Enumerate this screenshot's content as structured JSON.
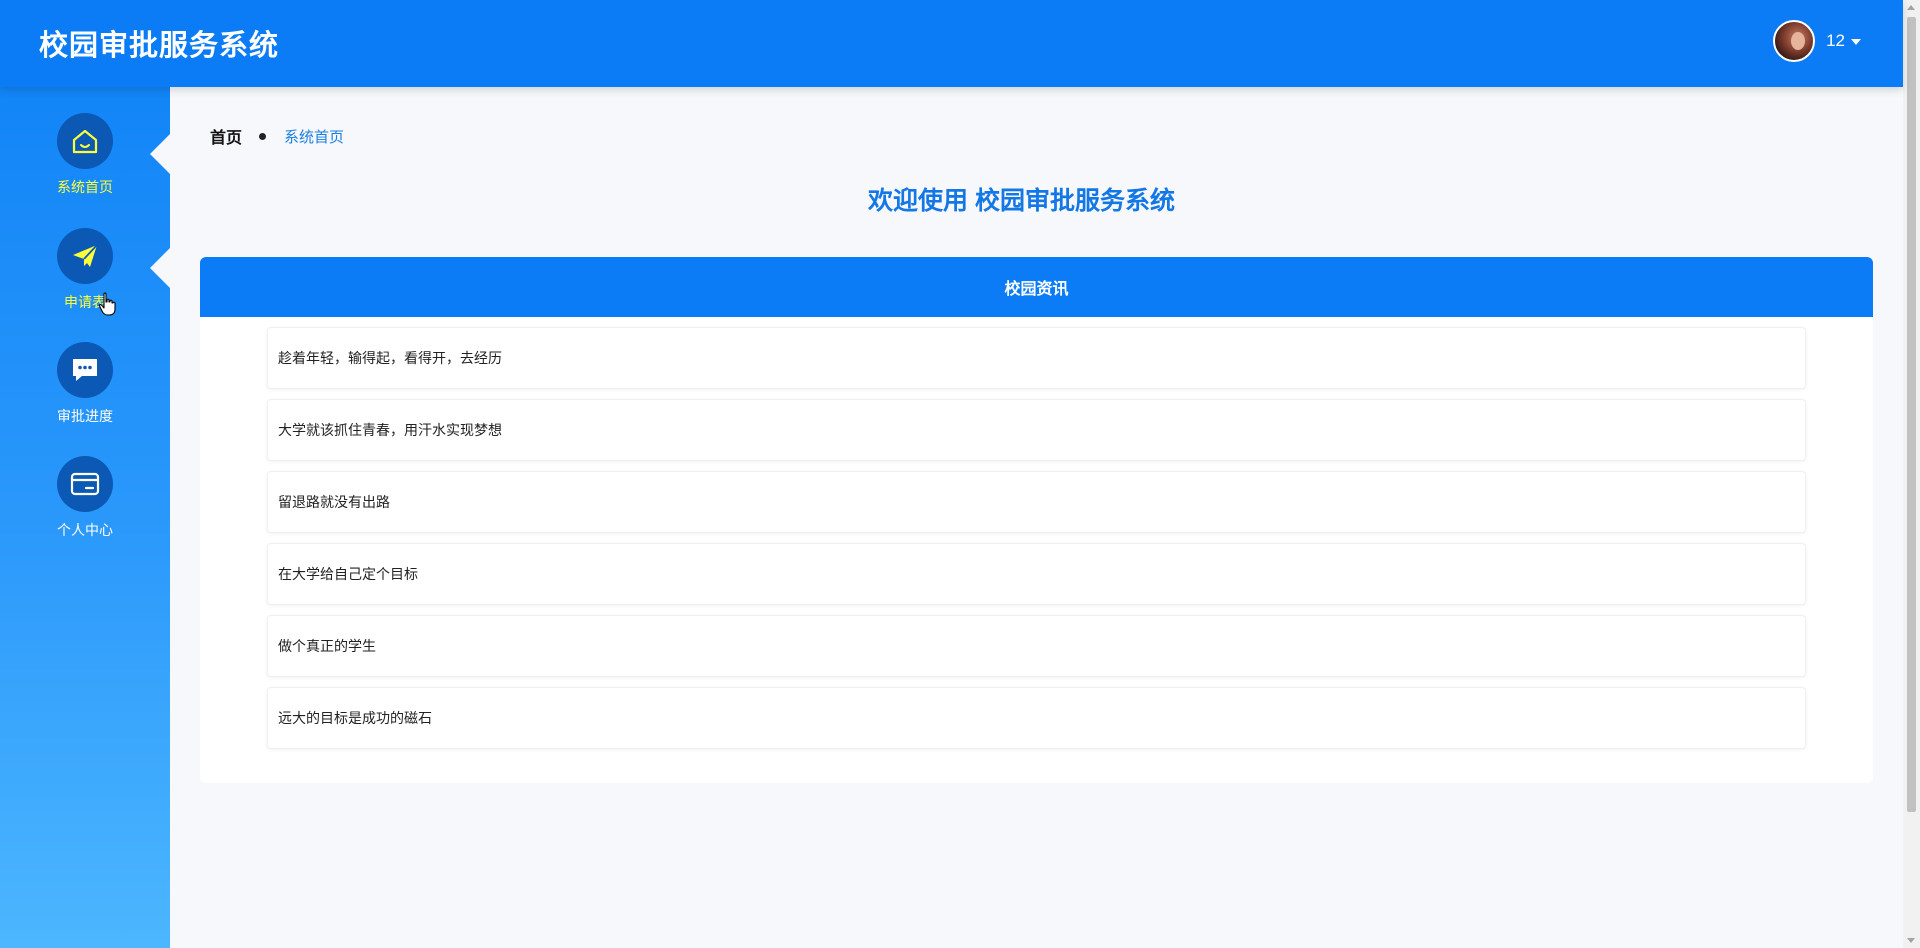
{
  "header": {
    "app_title": "校园审批服务系统",
    "user_name": "12"
  },
  "sidebar": {
    "items": [
      {
        "label": "系统首页",
        "icon": "home-icon",
        "active": true
      },
      {
        "label": "申请表",
        "icon": "paper-plane-icon",
        "active": false
      },
      {
        "label": "审批进度",
        "icon": "chat-bubble-icon",
        "active": false
      },
      {
        "label": "个人中心",
        "icon": "card-icon",
        "active": false
      }
    ]
  },
  "breadcrumb": {
    "home": "首页",
    "current": "系统首页"
  },
  "welcome_text": "欢迎使用 校园审批服务系统",
  "news": {
    "title": "校园资讯",
    "items": [
      "趁着年轻，输得起，看得开，去经历",
      "大学就该抓住青春，用汗水实现梦想",
      "留退路就没有出路",
      "在大学给自己定个目标",
      "做个真正的学生",
      "远大的目标是成功的磁石"
    ]
  },
  "colors": {
    "primary": "#0b7cf6",
    "active_label": "#ffff3a",
    "icon_circle": "#0b59b4",
    "welcome": "#1477e6"
  }
}
